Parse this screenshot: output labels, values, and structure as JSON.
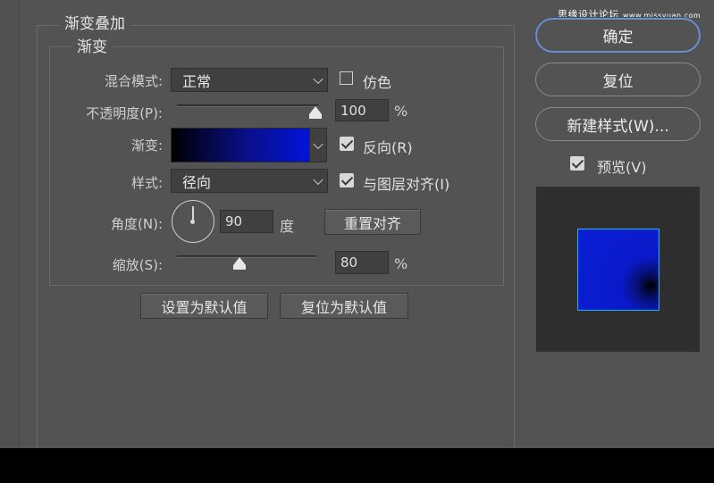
{
  "watermark": {
    "cn": "思缘设计论坛",
    "url": "www.missyuan.com"
  },
  "panel": {
    "outer_title": "渐变叠加",
    "inner_title": "渐变",
    "blend_mode": {
      "label": "混合模式:",
      "value": "正常"
    },
    "dither": {
      "label": "仿色",
      "checked": false
    },
    "opacity": {
      "label": "不透明度(P):",
      "value": "100",
      "unit": "%",
      "level_percent": 100
    },
    "gradient": {
      "label": "渐变:",
      "colors": [
        "#000000",
        "#0014d8"
      ]
    },
    "reverse": {
      "label": "反向(R)",
      "checked": true
    },
    "style": {
      "label": "样式:",
      "value": "径向"
    },
    "align_with_layer": {
      "label": "与图层对齐(I)",
      "checked": true
    },
    "angle": {
      "label": "角度(N):",
      "value": "90",
      "unit": "度"
    },
    "reset_alignment_button": "重置对齐",
    "scale": {
      "label": "缩放(S):",
      "value": "80",
      "unit": "%",
      "level_percent": 80
    },
    "set_default_button": "设置为默认值",
    "reset_default_button": "复位为默认值"
  },
  "side": {
    "ok_button": "确定",
    "reset_button": "复位",
    "new_style_button": "新建样式(W)...",
    "preview": {
      "label": "预览(V)",
      "checked": true
    }
  },
  "colors": {
    "accent_border": "#6f8fc7",
    "preview_edge": "#19b7e6",
    "gradient_end": "#0014d8"
  }
}
